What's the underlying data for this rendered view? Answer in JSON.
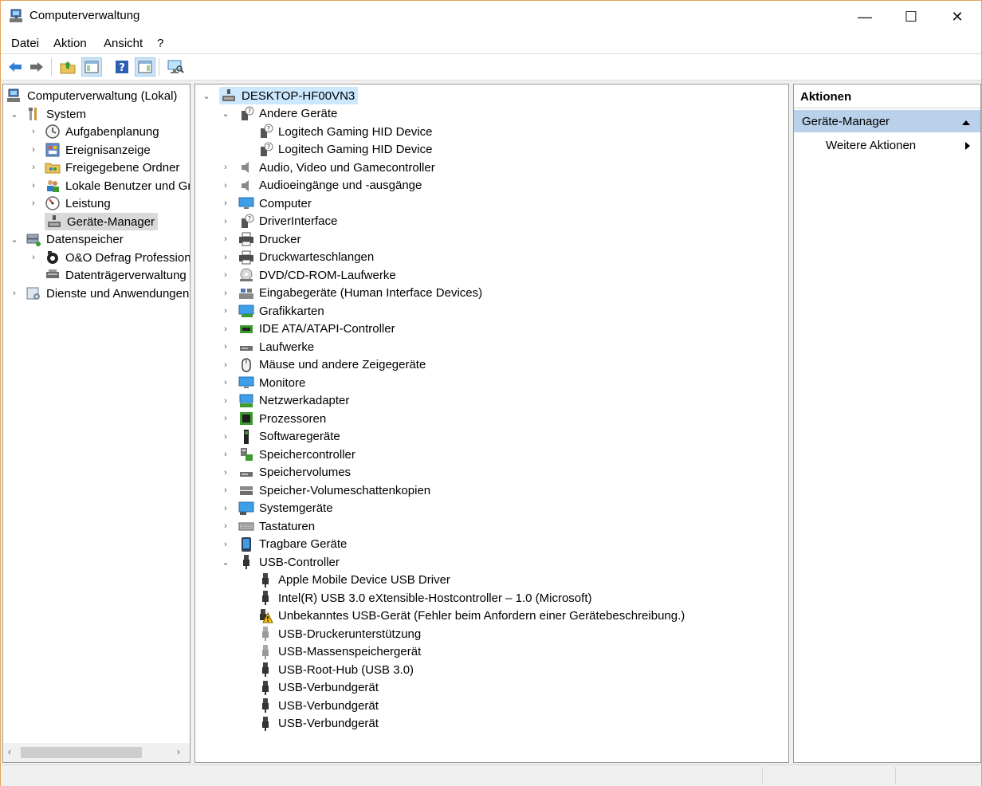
{
  "window": {
    "title": "Computerverwaltung",
    "minimize": "—",
    "maximize": "☐",
    "close": "✕"
  },
  "menu": [
    "Datei",
    "Aktion",
    "Ansicht",
    "?"
  ],
  "left_tree": {
    "root": "Computerverwaltung (Lokal)",
    "system": "System",
    "aufgaben": "Aufgabenplanung",
    "ereignis": "Ereignisanzeige",
    "freigaben": "Freigegebene Ordner",
    "benutzer": "Lokale Benutzer und Gruppen",
    "leistung": "Leistung",
    "geraete": "Geräte-Manager",
    "datenspeicher": "Datenspeicher",
    "defrag": "O&O Defrag Professional",
    "datentraeger": "Datenträgerverwaltung",
    "dienste": "Dienste und Anwendungen"
  },
  "device_tree": {
    "computer": "DESKTOP-HF00VN3",
    "andere": "Andere Geräte",
    "andere_children": [
      "Logitech Gaming HID Device",
      "Logitech Gaming HID Device"
    ],
    "categories": [
      "Audio, Video und Gamecontroller",
      "Audioeingänge und -ausgänge",
      "Computer",
      "DriverInterface",
      "Drucker",
      "Druckwarteschlangen",
      "DVD/CD-ROM-Laufwerke",
      "Eingabegeräte (Human Interface Devices)",
      "Grafikkarten",
      "IDE ATA/ATAPI-Controller",
      "Laufwerke",
      "Mäuse und andere Zeigegeräte",
      "Monitore",
      "Netzwerkadapter",
      "Prozessoren",
      "Softwaregeräte",
      "Speichercontroller",
      "Speichervolumes",
      "Speicher-Volumeschattenkopien",
      "Systemgeräte",
      "Tastaturen",
      "Tragbare Geräte"
    ],
    "usb": "USB-Controller",
    "usb_children": [
      "Apple Mobile Device USB Driver",
      "Intel(R) USB 3.0 eXtensible-Hostcontroller – 1.0 (Microsoft)",
      "Unbekanntes USB-Gerät (Fehler beim Anfordern einer Gerätebeschreibung.)",
      "USB-Druckerunterstützung",
      "USB-Massenspeichergerät",
      "USB-Root-Hub (USB 3.0)",
      "USB-Verbundgerät",
      "USB-Verbundgerät",
      "USB-Verbundgerät"
    ]
  },
  "actions": {
    "header": "Aktionen",
    "section": "Geräte-Manager",
    "more": "Weitere Aktionen"
  }
}
